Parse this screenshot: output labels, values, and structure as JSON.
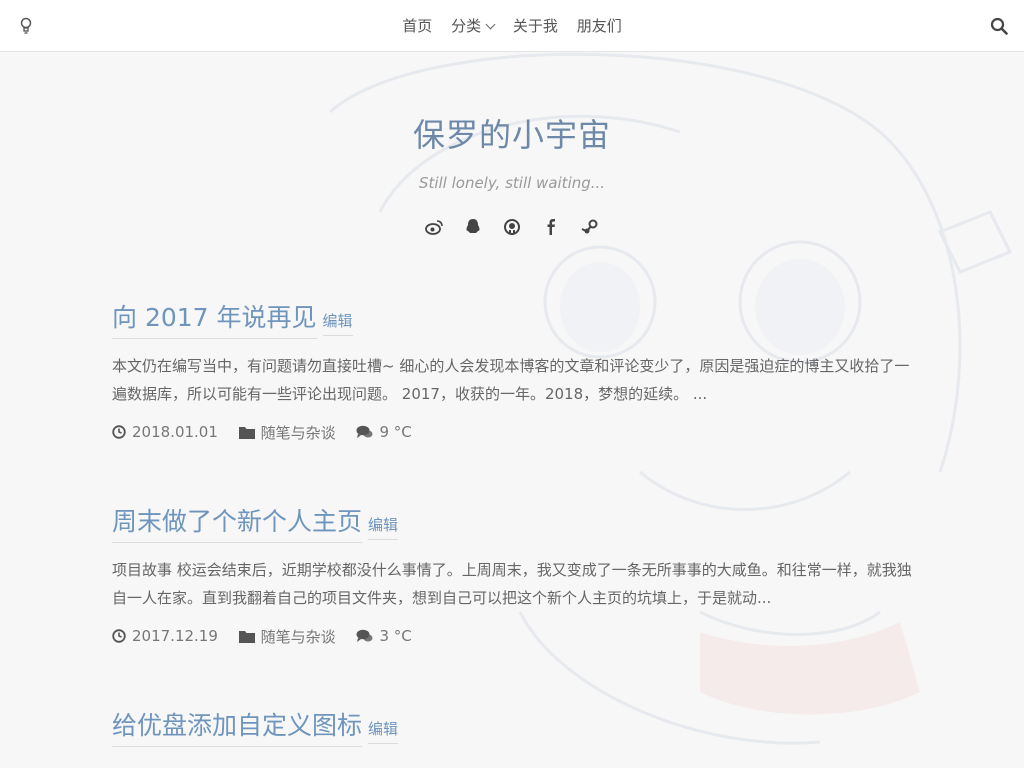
{
  "nav": {
    "items": [
      {
        "label": "首页"
      },
      {
        "label": "分类"
      },
      {
        "label": "关于我"
      },
      {
        "label": "朋友们"
      }
    ],
    "logo_icon": "lightbulb-icon",
    "search_icon": "search-icon"
  },
  "site": {
    "title": "保罗的小宇宙",
    "description": "Still lonely, still waiting..."
  },
  "social": [
    "weibo-icon",
    "qq-icon",
    "github-icon",
    "facebook-icon",
    "steam-icon"
  ],
  "colors": {
    "accent": "#6f95bd",
    "title": "#6d88a8",
    "text": "#666666",
    "background": "#f7f7f7"
  },
  "posts": [
    {
      "title": "向 2017 年说再见",
      "edit_label": "编辑",
      "excerpt": "本文仍在编写当中，有问题请勿直接吐槽~ 细心的人会发现本博客的文章和评论变少了，原因是强迫症的博主又收拾了一遍数据库，所以可能有一些评论出现问题。 2017，收获的一年。2018，梦想的延续。 ...",
      "date": "2018.01.01",
      "category": "随笔与杂谈",
      "temperature": "9 °C"
    },
    {
      "title": "周末做了个新个人主页",
      "edit_label": "编辑",
      "excerpt": "项目故事 校运会结束后，近期学校都没什么事情了。上周周末，我又变成了一条无所事事的大咸鱼。和往常一样，就我独自一人在家。直到我翻着自己的项目文件夹，想到自己可以把这个新个人主页的坑填上，于是就动...",
      "date": "2017.12.19",
      "category": "随笔与杂谈",
      "temperature": "3 °C"
    },
    {
      "title": "给优盘添加自定义图标",
      "edit_label": "编辑"
    }
  ]
}
